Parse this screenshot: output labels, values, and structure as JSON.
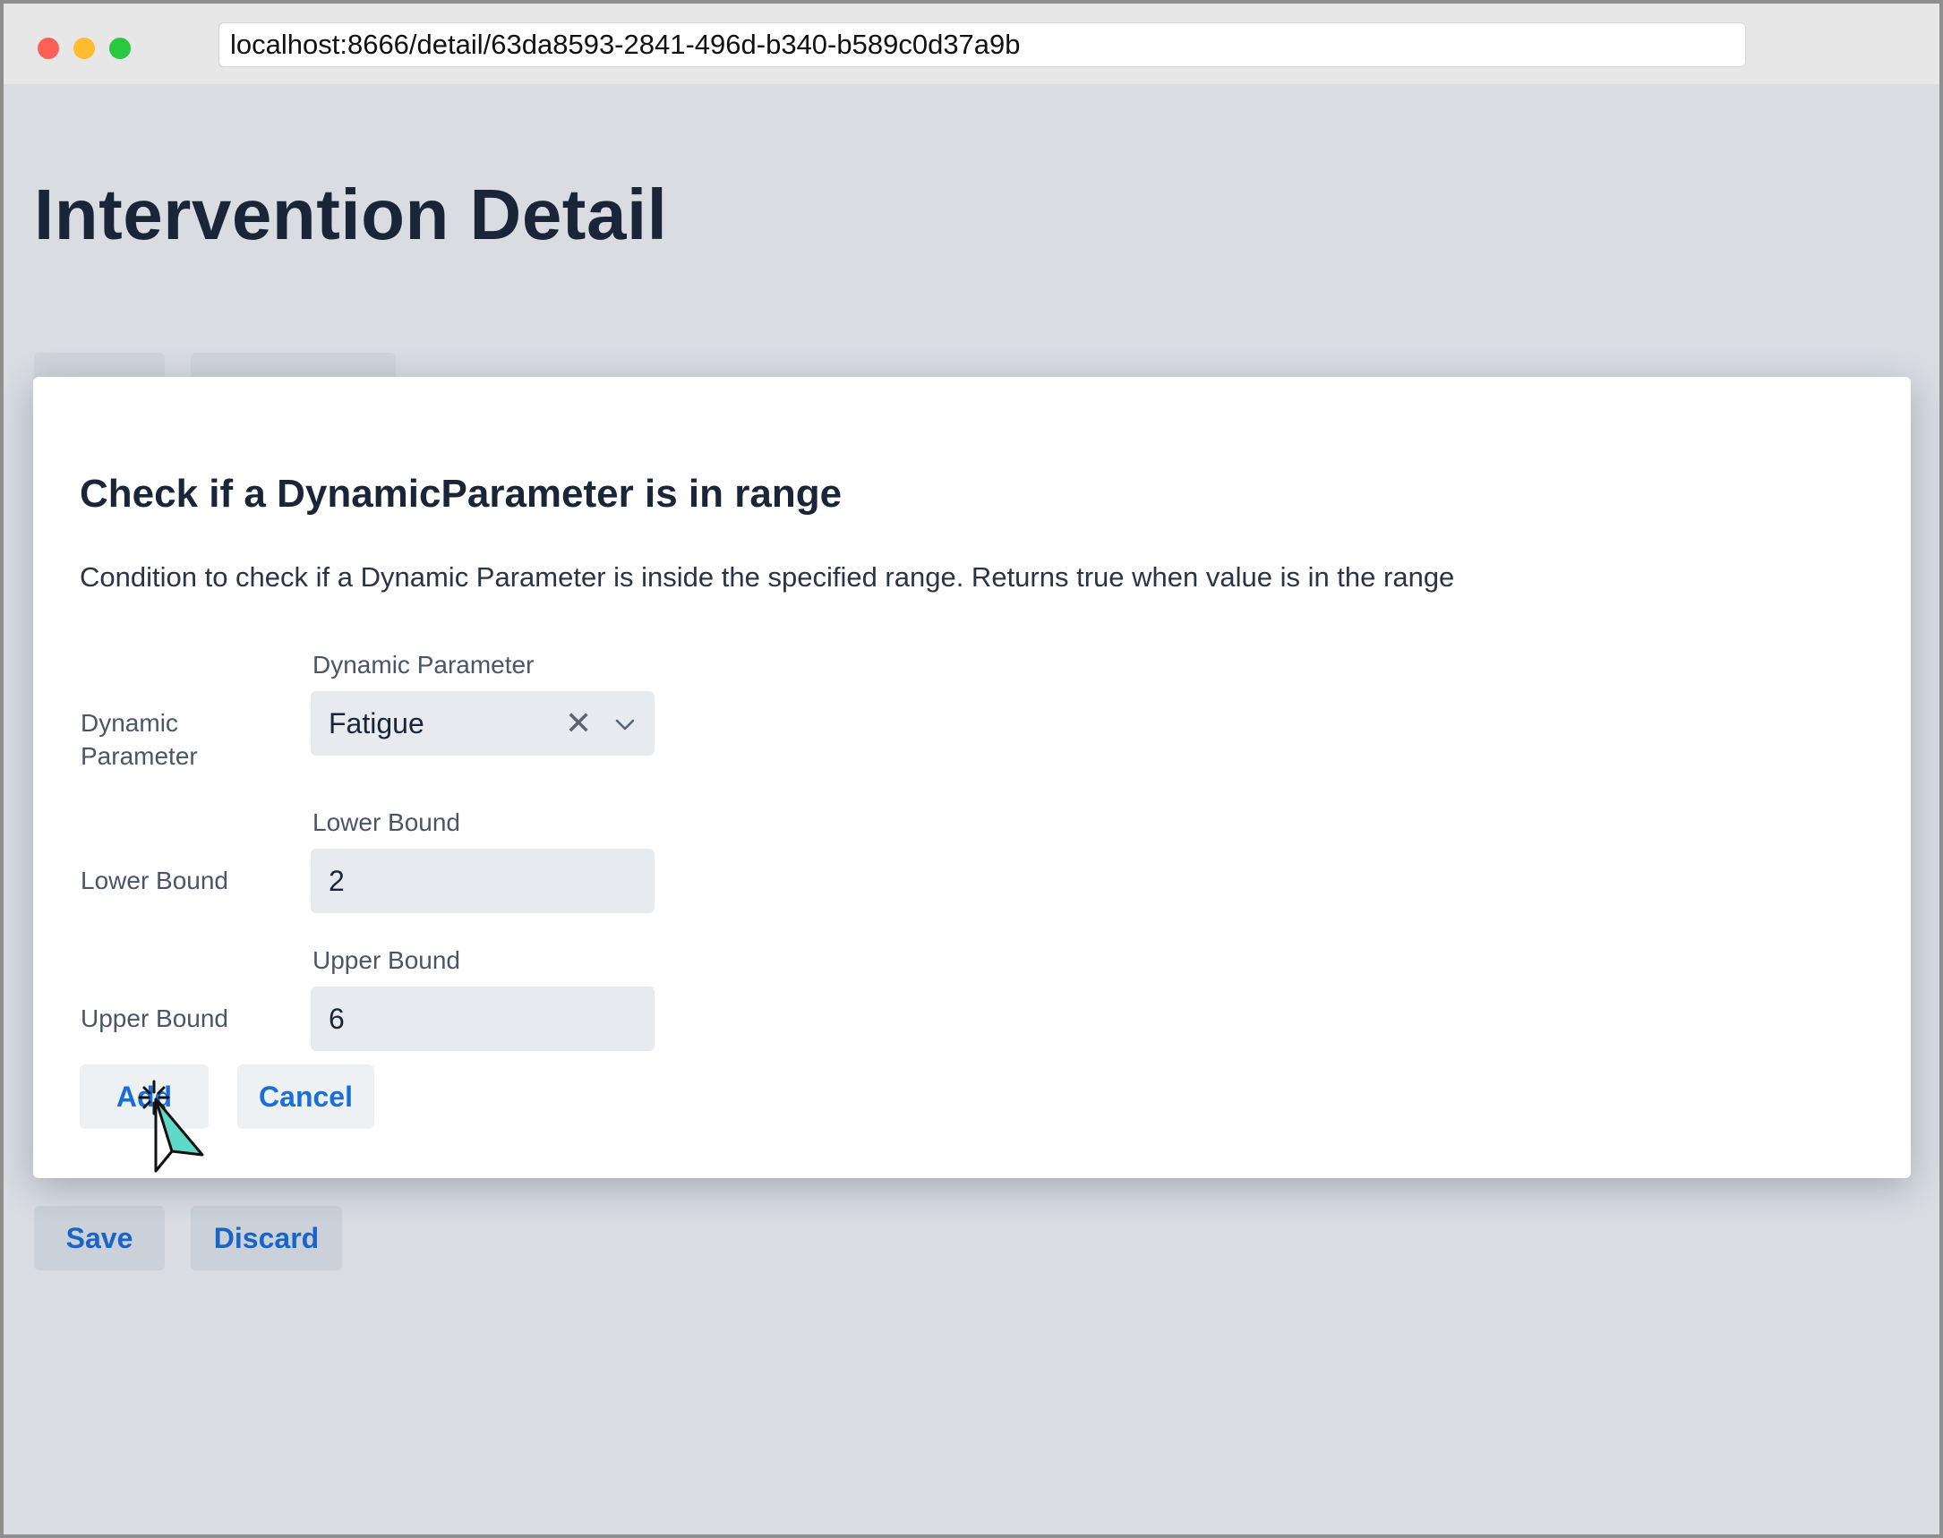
{
  "browser": {
    "url": "localhost:8666/detail/63da8593-2841-496d-b340-b589c0d37a9b"
  },
  "page": {
    "title": "Intervention Detail",
    "save_label": "Save",
    "discard_label": "Discard"
  },
  "modal": {
    "title": "Check if a DynamicParameter is in range",
    "description": "Condition to check if a Dynamic Parameter is inside the specified range. Returns true when value is in the range",
    "fields": [
      {
        "row_label": "Dynamic Parameter",
        "field_label": "Dynamic Parameter",
        "value": "Fatigue"
      },
      {
        "row_label": "Lower Bound",
        "field_label": "Lower Bound",
        "value": "2"
      },
      {
        "row_label": "Upper Bound",
        "field_label": "Upper Bound",
        "value": "6"
      }
    ],
    "add_label": "Add",
    "cancel_label": "Cancel"
  },
  "icons": {
    "select_clear": "close-icon",
    "select_dropdown": "chevron-down-icon",
    "cursor": "mouse-pointer-icon"
  },
  "colors": {
    "accent": "#1a6ed8",
    "title": "#1a2638",
    "page_bg": "#d9dde2",
    "field_bg": "#e7ebef"
  }
}
